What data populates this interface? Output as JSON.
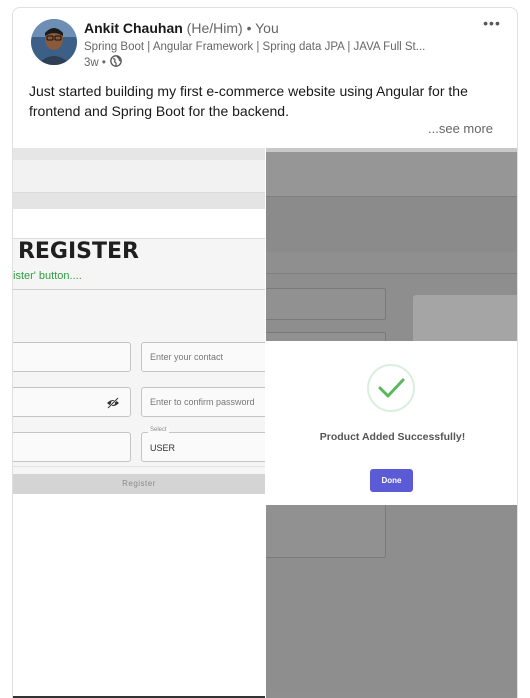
{
  "post": {
    "author": {
      "name": "Ankit Chauhan",
      "pronouns": "(He/Him)",
      "connection": "• You",
      "headline": "Spring Boot | Angular Framework | Spring data JPA | JAVA Full St...",
      "time": "3w •",
      "visibility_icon": "globe-icon"
    },
    "more_icon": "•••",
    "text": "Just started building my first e-commerce website using Angular for the frontend and Spring Boot for the backend.",
    "see_more": "...see more"
  },
  "media": {
    "left": {
      "title": "REGISTER",
      "hint": "ister' button....",
      "fields": {
        "contact_placeholder": "Enter your contact",
        "confirm_password_placeholder": "Enter to confirm password",
        "role_label": "Select",
        "role_value": "USER"
      },
      "register_button": "Register"
    },
    "right": {
      "message": "Product Added Successfully!",
      "done_button": "Done"
    }
  },
  "colors": {
    "hint_green": "#2e9e3e",
    "done_button": "#5b5bd6",
    "check_green": "#5cb85c",
    "overlay_grey": "#8f8f8f"
  }
}
